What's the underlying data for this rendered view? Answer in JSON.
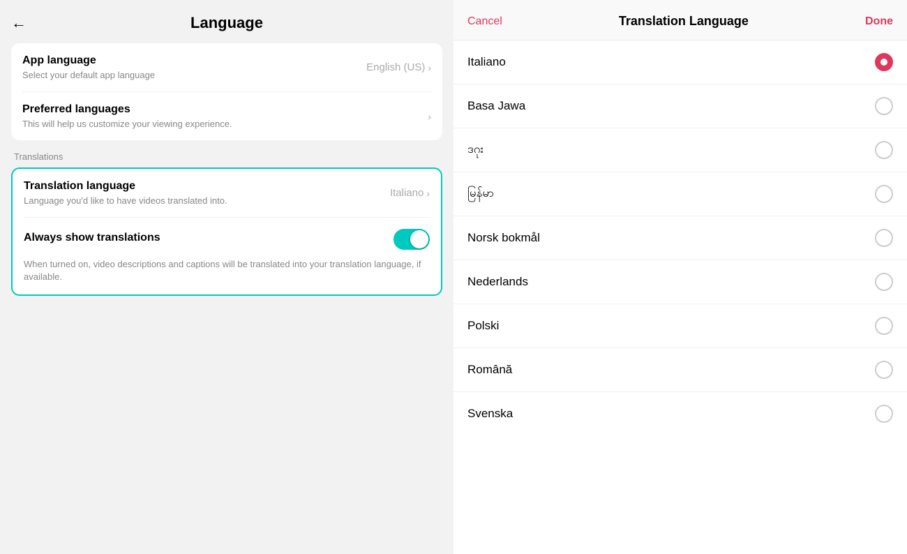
{
  "left": {
    "back_arrow": "←",
    "title": "Language",
    "app_language": {
      "label": "App language",
      "sublabel": "Select your default app language",
      "value": "English (US)"
    },
    "preferred_languages": {
      "label": "Preferred languages",
      "sublabel": "This will help us customize your viewing experience."
    },
    "translations_section_label": "Translations",
    "translation_language": {
      "label": "Translation language",
      "sublabel": "Language you'd like to have videos translated into.",
      "value": "Italiano"
    },
    "always_show_translations": {
      "label": "Always show translations",
      "description": "When turned on, video descriptions and captions will be translated into your translation language, if available."
    }
  },
  "right": {
    "cancel_label": "Cancel",
    "title": "Translation Language",
    "done_label": "Done",
    "languages": [
      {
        "name": "Italiano",
        "selected": true
      },
      {
        "name": "Basa Jawa",
        "selected": false
      },
      {
        "name": "ဒဂုး",
        "selected": false
      },
      {
        "name": "မြန်မာ",
        "selected": false
      },
      {
        "name": "Norsk bokmål",
        "selected": false
      },
      {
        "name": "Nederlands",
        "selected": false
      },
      {
        "name": "Polski",
        "selected": false
      },
      {
        "name": "Română",
        "selected": false
      },
      {
        "name": "Svenska",
        "selected": false
      }
    ]
  }
}
